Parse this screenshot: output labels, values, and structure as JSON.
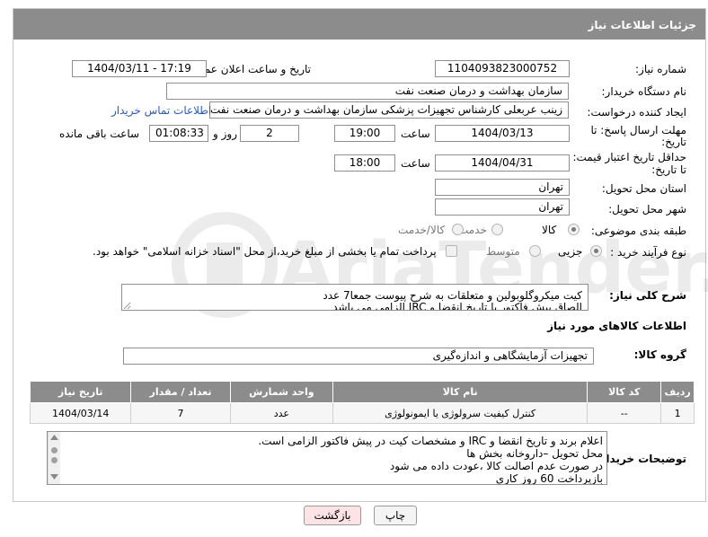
{
  "header": {
    "title": "جزئیات اطلاعات نیاز"
  },
  "form": {
    "need_number": {
      "label": "شماره نیاز:",
      "value": "1104093823000752"
    },
    "announce_datetime": {
      "label": "تاریخ و ساعت اعلان عمومی:",
      "value": "1404/03/11 - 17:19"
    },
    "buyer_org": {
      "label": "نام دستگاه خریدار:",
      "value": "سازمان بهداشت و درمان صنعت نفت"
    },
    "requester": {
      "label": "ایجاد کننده درخواست:",
      "value": "زینب عربعلی کارشناس تجهیزات پزشکی سازمان بهداشت و درمان صنعت نفت",
      "contact_link": "اطلاعات تماس خریدار"
    },
    "reply_deadline": {
      "label_line1": "مهلت ارسال پاسخ: تا",
      "label_line2": "تاریخ:",
      "date": "1404/03/13",
      "time_label": "ساعت",
      "time": "19:00",
      "days": "2",
      "days_label": "روز و",
      "remaining": "01:08:33",
      "remaining_label": "ساعت باقی مانده"
    },
    "price_validity": {
      "label_line1": "حداقل تاریخ اعتبار قیمت:",
      "label_line2": "تا تاریخ:",
      "date": "1404/04/31",
      "time_label": "ساعت",
      "time": "18:00"
    },
    "delivery_province": {
      "label": "استان محل تحویل:",
      "value": "تهران"
    },
    "delivery_city": {
      "label": "شهر محل تحویل:",
      "value": "تهران"
    },
    "category": {
      "label": "طبقه بندی موضوعی:",
      "options": [
        "کالا",
        "خدمت",
        "کالا/خدمت"
      ],
      "selected": "کالا"
    },
    "purchase_process": {
      "label": "نوع فرآیند خرید :",
      "options": [
        "جزیی",
        "متوسط"
      ],
      "selected": "جزیی",
      "payment_note": "پرداخت تمام یا بخشی از مبلغ خرید،از محل \"اسناد خزانه اسلامی\" خواهد بود."
    },
    "general_description": {
      "label": "شرح کلی نیاز:",
      "lines": [
        "کیت میکروگلوبولین و متعلقات به شرح پیوست جمعا7 عدد",
        "الصاق پیش فاکتور با تاریخ انقضا و IRC  الزامی می باشد"
      ]
    }
  },
  "goods_section": {
    "title": "اطلاعات کالاهای مورد نیاز",
    "group_label": "گروه کالا:",
    "group_value": "تجهیزات آزمایشگاهی و اندازه‌گیری",
    "columns": [
      "ردیف",
      "کد کالا",
      "نام کالا",
      "واحد شمارش",
      "تعداد / مقدار",
      "تاریخ نیاز"
    ],
    "rows": [
      {
        "row": "1",
        "code": "--",
        "name": "کنترل کیفیت سرولوژی یا ایمونولوژی",
        "unit": "عدد",
        "qty": "7",
        "date": "1404/03/14"
      }
    ]
  },
  "buyer_notes": {
    "label": "توضیحات خریدار:",
    "lines": [
      "اعلام برند و تاریخ انقضا  و IRC  و مشخصات کیت در پیش فاکتور الزامی است.",
      "محل تحویل –داروخانه بخش ها",
      "در صورت عدم اصالت کالا ،عودت داده می شود",
      "بازپرداخت 60 روز کاری"
    ]
  },
  "buttons": {
    "print": "چاپ",
    "back": "بازگشت"
  },
  "watermark_text": "AriaTender.neT",
  "colors": {
    "header_bg": "#8c8c8c",
    "link": "#2a5db0",
    "back_button_bg": "#fde3e3"
  }
}
